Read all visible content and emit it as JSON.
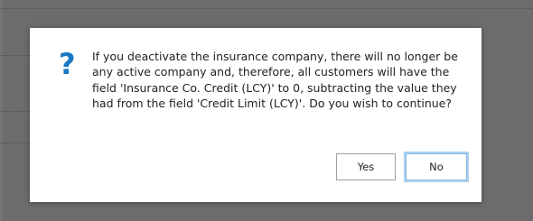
{
  "dialog": {
    "icon": "question-mark-icon",
    "icon_glyph": "?",
    "message": "If you deactivate the insurance company, there will no longer be any active company and, therefore, all customers will have the field 'Insurance Co. Credit (LCY)' to 0, subtracting the value they had from the field 'Credit Limit (LCY)'. Do you wish to continue?",
    "yes_label": "Yes",
    "no_label": "No"
  },
  "colors": {
    "icon": "#1a78c2",
    "overlay": "#6c6c6c",
    "focus_ring": "#a9d2f2"
  }
}
